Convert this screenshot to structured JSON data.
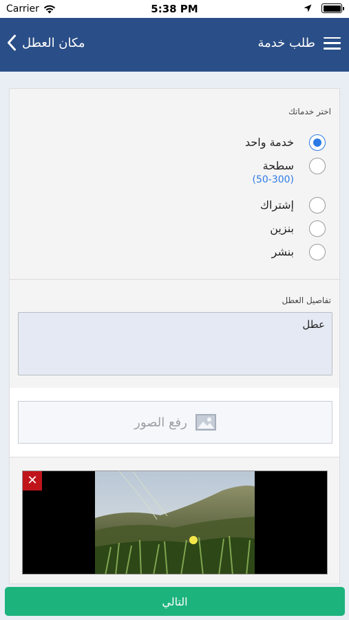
{
  "status_bar": {
    "carrier": "Carrier",
    "time": "5:38 PM",
    "icons": [
      "wifi-icon",
      "location-arrow-icon",
      "battery-icon"
    ]
  },
  "navbar": {
    "back_label": "مكان العطل",
    "title": "طلب خدمة",
    "background": "#2a4e87",
    "icons": [
      "chevron-left-icon",
      "hamburger-menu-icon"
    ]
  },
  "services": {
    "label": "اختر خدماتك",
    "options": [
      {
        "label": "خدمة واحد",
        "sub": "",
        "selected": true
      },
      {
        "label": "سطحة",
        "sub": "(50-300)",
        "selected": false
      },
      {
        "label": "إشتراك",
        "sub": "",
        "selected": false
      },
      {
        "label": "بنزين",
        "sub": "",
        "selected": false
      },
      {
        "label": "بنشر",
        "sub": "",
        "selected": false
      }
    ],
    "accent": "#2c7be5"
  },
  "details": {
    "label": "تفاصيل العطل",
    "value": "عطل"
  },
  "upload": {
    "label": "رفع الصور",
    "icon": "image-icon"
  },
  "photo": {
    "close_icon": "close-icon",
    "close_color": "#c0141b"
  },
  "next_button": {
    "label": "التالي",
    "color": "#1db37d"
  }
}
